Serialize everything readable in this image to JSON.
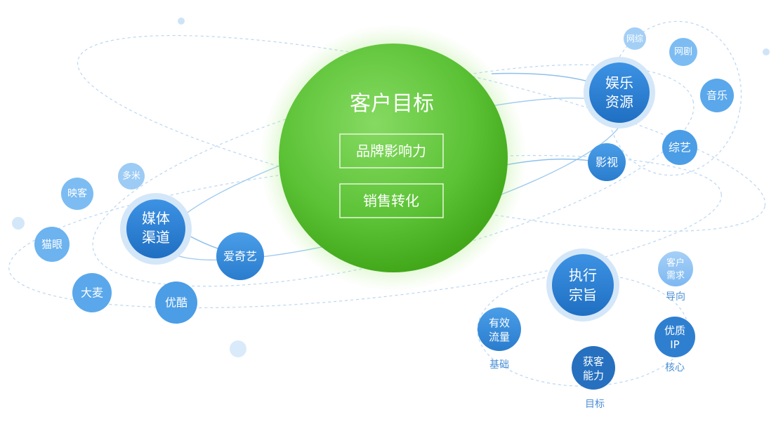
{
  "colors": {
    "center_light": "#7fd65c",
    "center_dark": "#41a81a",
    "hub_blue": "#2e7fd3",
    "node_blue": "#3a8fe0",
    "node_light": "#8fc4f5",
    "halo": "#d7e9fa",
    "caption_blue": "#4a8fd6"
  },
  "center": {
    "title": "客户目标",
    "items": [
      "品牌影响力",
      "销售转化"
    ]
  },
  "media": {
    "hub": [
      "媒体",
      "渠道"
    ],
    "nodes": {
      "aiqiyi": "爱奇艺",
      "youku": "优酷",
      "damai": "大麦",
      "maoyan": "猫眼",
      "yingke": "映客",
      "duomi": "多米"
    }
  },
  "entertainment": {
    "hub": [
      "娱乐",
      "资源"
    ],
    "nodes": {
      "yingshi": "影视",
      "zongyi": "综艺",
      "yinyue": "音乐",
      "wangju": "网剧",
      "wangzong": "网综"
    }
  },
  "execution": {
    "hub": [
      "执行",
      "宗旨"
    ],
    "nodes": {
      "traffic": {
        "lines": [
          "有效",
          "流量"
        ],
        "caption": "基础"
      },
      "acquire": {
        "lines": [
          "获客",
          "能力"
        ],
        "caption": "目标"
      },
      "ip": {
        "lines": [
          "优质",
          "IP"
        ],
        "caption": "核心"
      },
      "demand": {
        "lines": [
          "客户",
          "需求"
        ],
        "caption": "导向"
      }
    }
  }
}
